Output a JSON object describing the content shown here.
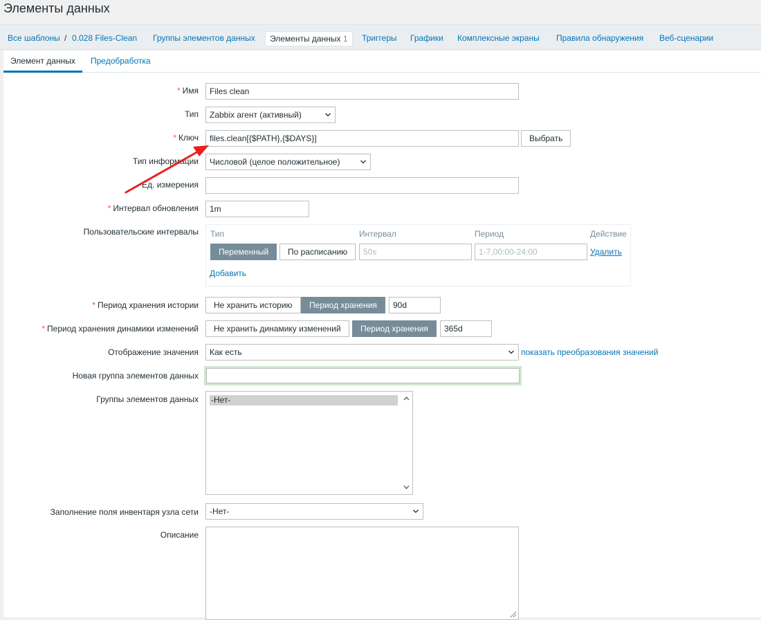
{
  "page_title": "Элементы данных",
  "nav": {
    "all_templates": "Все шаблоны",
    "separator": "/",
    "template_name": "0.028 Files-Clean",
    "item_groups": "Группы элементов данных",
    "items": "Элементы данных",
    "items_count": "1",
    "triggers": "Триггеры",
    "graphs": "Графики",
    "screens": "Комплексные экраны",
    "discovery": "Правила обнаружения",
    "web": "Веб-сценарии"
  },
  "tabs": {
    "item": "Элемент данных",
    "preprocessing": "Предобработка"
  },
  "form": {
    "name": {
      "label": "Имя",
      "value": "Files clean"
    },
    "type": {
      "label": "Тип",
      "value": "Zabbix агент (активный)"
    },
    "key": {
      "label": "Ключ",
      "value": "files.clean[{$PATH},{$DAYS}]",
      "select_button": "Выбрать"
    },
    "info_type": {
      "label": "Тип информации",
      "value": "Числовой (целое положительное)"
    },
    "units": {
      "label": "Ед. измерения",
      "value": ""
    },
    "interval": {
      "label": "Интервал обновления",
      "value": "1m"
    },
    "custom_intervals": {
      "label": "Пользовательские интервалы",
      "headers": {
        "type": "Тип",
        "interval": "Интервал",
        "period": "Период",
        "action": "Действие"
      },
      "type_flexible": "Переменный",
      "type_scheduling": "По расписанию",
      "interval_placeholder": "50s",
      "period_placeholder": "1-7,00:00-24:00",
      "remove": "Удалить",
      "add": "Добавить"
    },
    "history": {
      "label": "Период хранения истории",
      "no_keep": "Не хранить историю",
      "keep": "Период хранения",
      "value": "90d"
    },
    "trends": {
      "label": "Период хранения динамики изменений",
      "no_keep": "Не хранить динамику изменений",
      "keep": "Период хранения",
      "value": "365d"
    },
    "valuemap": {
      "label": "Отображение значения",
      "value": "Как есть",
      "link": "показать преобразования значений"
    },
    "new_group": {
      "label": "Новая группа элементов данных",
      "value": ""
    },
    "groups": {
      "label": "Группы элементов данных",
      "options": [
        "-Нет-"
      ]
    },
    "inventory": {
      "label": "Заполнение поля инвентаря узла сети",
      "value": "-Нет-"
    },
    "description": {
      "label": "Описание",
      "value": ""
    }
  },
  "colors": {
    "link": "#0275b8",
    "required": "#e45959",
    "toggle_active": "#768d99",
    "annotation_arrow": "#e8201f",
    "focus_glow": "#cfe7cf"
  }
}
